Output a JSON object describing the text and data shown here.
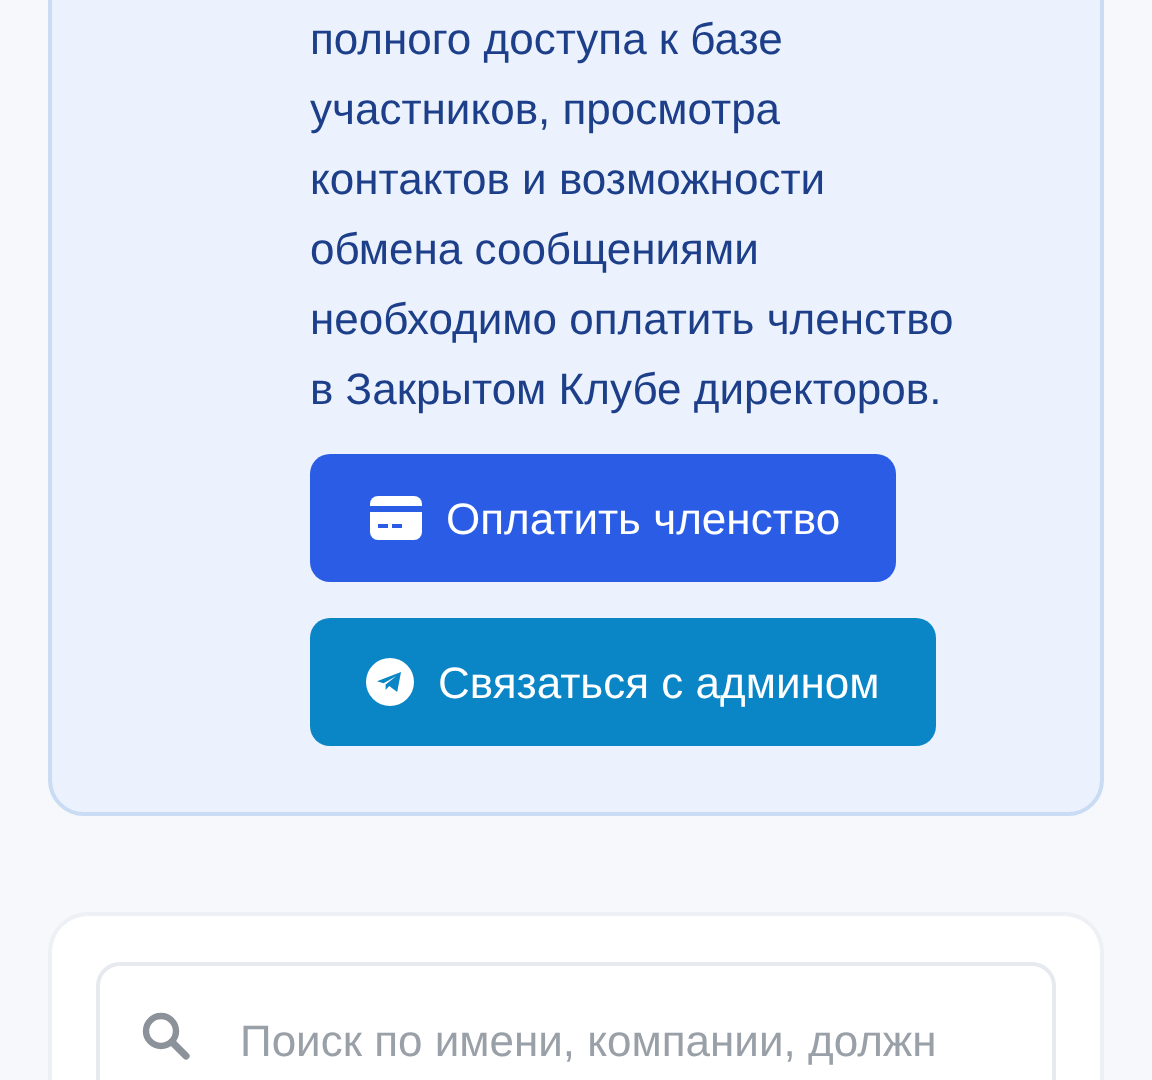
{
  "notice": {
    "text_lines": [
      "полного доступа к базе",
      "участников, просмотра",
      "контактов и возможности",
      "обмена сообщениями",
      "необходимо оплатить членство",
      "в Закрытом Клубе директоров."
    ],
    "buttons": [
      {
        "kind": "pay",
        "label": "Оплатить членство"
      },
      {
        "kind": "contact",
        "label": "Связаться с админом"
      }
    ]
  },
  "search": {
    "placeholder": "Поиск по имени, компании, должн"
  }
}
